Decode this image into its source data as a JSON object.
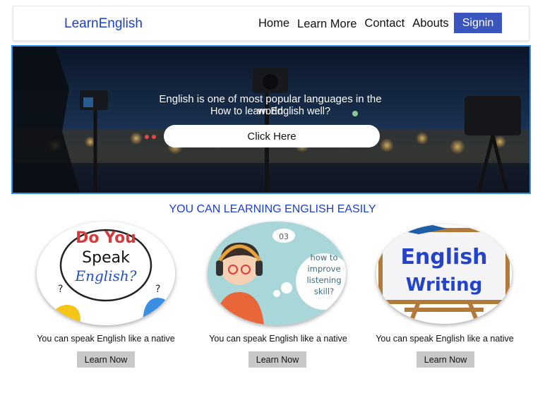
{
  "header": {
    "brand": "LearnEnglish",
    "nav": [
      "Home",
      "Learn More",
      "Contact",
      "Abouts"
    ],
    "signin_label": "Signin"
  },
  "hero": {
    "line1": "English is one of most popular languages in the world",
    "line2": "How to learn English well?",
    "button_label": "Click Here"
  },
  "section": {
    "title": "YOU CAN LEARNING ENGLISH EASILY"
  },
  "cards": [
    {
      "image_text": [
        "Do You",
        "Speak",
        "English?"
      ],
      "description": "You can speak English like a native",
      "button_label": "Learn Now"
    },
    {
      "image_text": [
        "03",
        "how to",
        "improve",
        "listening",
        "skill?"
      ],
      "description": "You can speak English like a native",
      "button_label": "Learn Now"
    },
    {
      "image_text": [
        "English",
        "Writing"
      ],
      "description": "You can speak English like a native",
      "button_label": "Learn Now"
    }
  ],
  "colors": {
    "brand": "#1b3fd0",
    "signin_bg": "#3b55bf",
    "hero_border": "#2f8ee6",
    "learn_now_bg": "#c8c8c8"
  }
}
